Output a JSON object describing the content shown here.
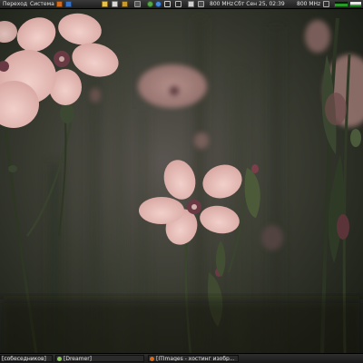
{
  "top_panel": {
    "menu_places": "Переход",
    "menu_system": "Система",
    "cpu_freq_1": "800 MHz",
    "datetime": "Сбт Сен 25, 02:39",
    "cpu_freq_2": "800 MHz",
    "icons": [
      "firefox-icon",
      "help-icon",
      "folder-icon",
      "text-editor-icon",
      "package-manager-icon",
      "screenshot-icon",
      "shutdown-icon",
      "chat-icon",
      "network-icon",
      "volume-icon",
      "mail-icon",
      "battery-icon",
      "wifi-icon",
      "system-monitor-icon"
    ]
  },
  "bottom_panel": {
    "task_1": "[собеседников]",
    "task_2": "[Dreamer]",
    "task_3": "[ITImages - хостинг изобр..."
  },
  "colors": {
    "panel_bg": "#1e1e1e",
    "panel_text": "#e4e4e4",
    "flower_petal": "#e6b8b4",
    "background_dark": "#1e2418"
  }
}
